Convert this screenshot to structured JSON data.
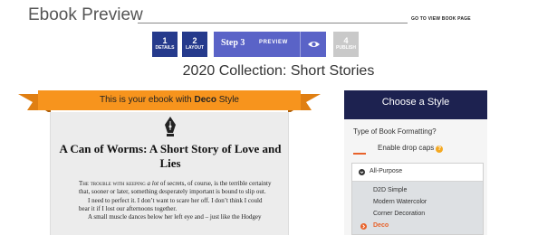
{
  "header": {
    "title": "Ebook Preview",
    "view_link": "GO TO VIEW BOOK PAGE"
  },
  "steps": [
    {
      "number": "1",
      "label": "DETAILS"
    },
    {
      "number": "2",
      "label": "LAYOUT"
    },
    {
      "number": "Step 3",
      "label": "PREVIEW",
      "icon": "eye-icon"
    },
    {
      "number": "4",
      "label": "PUBLISH"
    }
  ],
  "collection_title": "2020 Collection: Short Stories",
  "ribbon": {
    "prefix": "This is your ebook with ",
    "style_name": "Deco",
    "suffix": " Style"
  },
  "ebook": {
    "ornament": "fountain-pen-nib-icon",
    "title": "A Can of Worms: A Short Story of Love and Lies",
    "para1_caps": "The trouble with keeping",
    "para1_em": "a lot",
    "para1_rest": "of secrets, of course, is the terrible certainty that, sooner or later, something desperately important is bound to slip out.",
    "para2": "I need to perfect it. I don’t want to scare her off. I don’t think I could bear it if I lost our afternoons together.",
    "para3": "A small muscle dances below her left eye and – just like the Hodgey"
  },
  "style_panel": {
    "heading": "Choose a Style",
    "format_question": "Type of Book Formatting?",
    "drop_caps_label": "Enable drop caps",
    "drop_caps_help": "?",
    "group_label": "All-Purpose",
    "options": [
      "D2D Simple",
      "Modern Watercolor",
      "Corner Decoration",
      "Deco"
    ],
    "selected": "Deco"
  },
  "colors": {
    "step_active": "#253a8c",
    "step_current": "#5a63c7",
    "step_pending": "#c9c9c9",
    "ribbon_orange": "#f7941d",
    "panel_navy": "#1d2250",
    "accent_orange": "#e8622a"
  }
}
